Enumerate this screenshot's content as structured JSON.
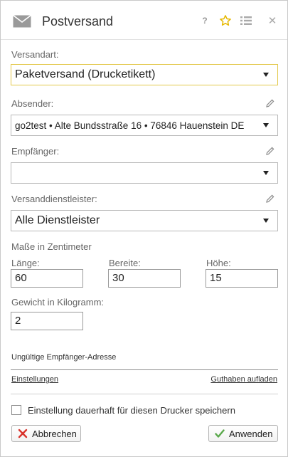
{
  "dialog": {
    "title": "Postversand",
    "icons": {
      "app": "mail-icon",
      "help": "help-icon",
      "favorite": "star-icon",
      "list": "list-icon",
      "close": "close-icon"
    },
    "help_glyph": "?",
    "close_glyph": "✕"
  },
  "shipping_type": {
    "label": "Versandart:",
    "value": "Paketversand (Drucketikett)"
  },
  "sender": {
    "label": "Absender:",
    "value": "go2test • Alte Bundsstraße 16 • 76846 Hauenstein DE"
  },
  "recipient": {
    "label": "Empfänger:",
    "value": ""
  },
  "provider": {
    "label": "Versanddienstleister:",
    "value": "Alle Dienstleister"
  },
  "dimensions": {
    "heading": "Maße in Zentimeter",
    "length": {
      "label": "Länge:",
      "value": "60"
    },
    "width": {
      "label": "Bereite:",
      "value": "30"
    },
    "height": {
      "label": "Höhe:",
      "value": "15"
    }
  },
  "weight": {
    "label": "Gewicht in Kilogramm:",
    "value": "2"
  },
  "warning": "Ungültige Empfänger-Adresse",
  "links": {
    "settings": "Einstellungen",
    "topup": "Guthaben aufladen"
  },
  "save_printer": {
    "label": "Einstellung dauerhaft für diesen Drucker speichern",
    "checked": false
  },
  "buttons": {
    "cancel": "Abbrechen",
    "apply": "Anwenden"
  },
  "colors": {
    "accent_star": "#e6b800",
    "cancel_x": "#d9322b",
    "apply_check": "#59a84a",
    "active_border": "#e3c84a"
  }
}
